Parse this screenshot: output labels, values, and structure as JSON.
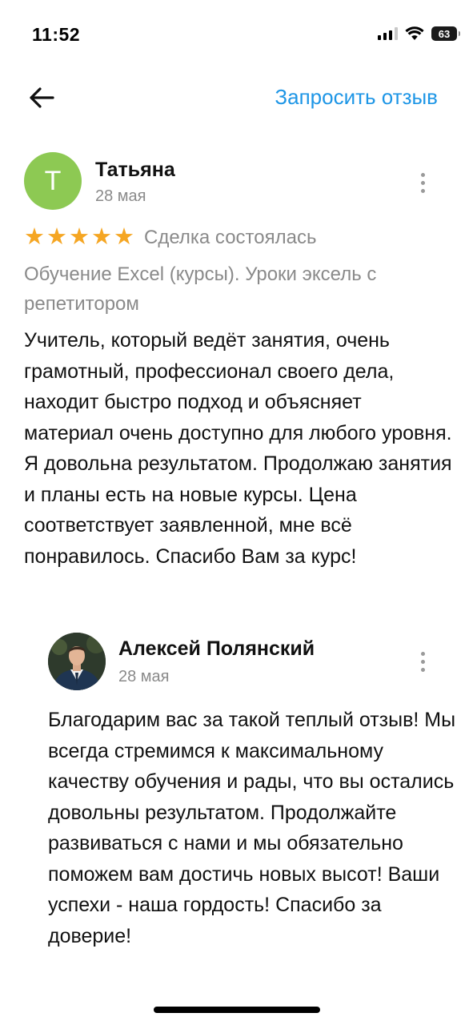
{
  "status_bar": {
    "time": "11:52",
    "battery": "63"
  },
  "nav": {
    "back_icon": "arrow-left-icon",
    "request_review": "Запросить отзыв"
  },
  "review": {
    "avatar_letter": "Т",
    "avatar_color": "#8dc953",
    "author": "Татьяна",
    "date": "28 мая",
    "rating": 5,
    "rating_max": 5,
    "deal_status": "Сделка состоялась",
    "service": "Обучение Excel (курсы). Уроки эксель с репетитором",
    "text": "Учитель, который ведёт занятия, очень грамотный, профессионал своего дела, находит быстро подход и объясняет материал очень доступно для любого уровня. Я довольна результатом. Продолжаю занятия и планы есть на новые курсы. Цена соответствует заявленной, мне всё понравилось. Спасибо Вам за курс!"
  },
  "reply": {
    "author": "Алексей Полянский",
    "date": "28 мая",
    "text": "Благодарим вас за такой теплый отзыв! Мы всегда стремимся к максимальному качеству обучения и рады, что вы остались довольны результатом. Продолжайте развиваться с нами и мы обязательно поможем вам достичь новых высот! Ваши успехи - наша гордость! Спасибо за доверие!"
  },
  "colors": {
    "accent": "#1e96e6",
    "star": "#f5a623",
    "secondary_text": "#8a8a8a"
  }
}
